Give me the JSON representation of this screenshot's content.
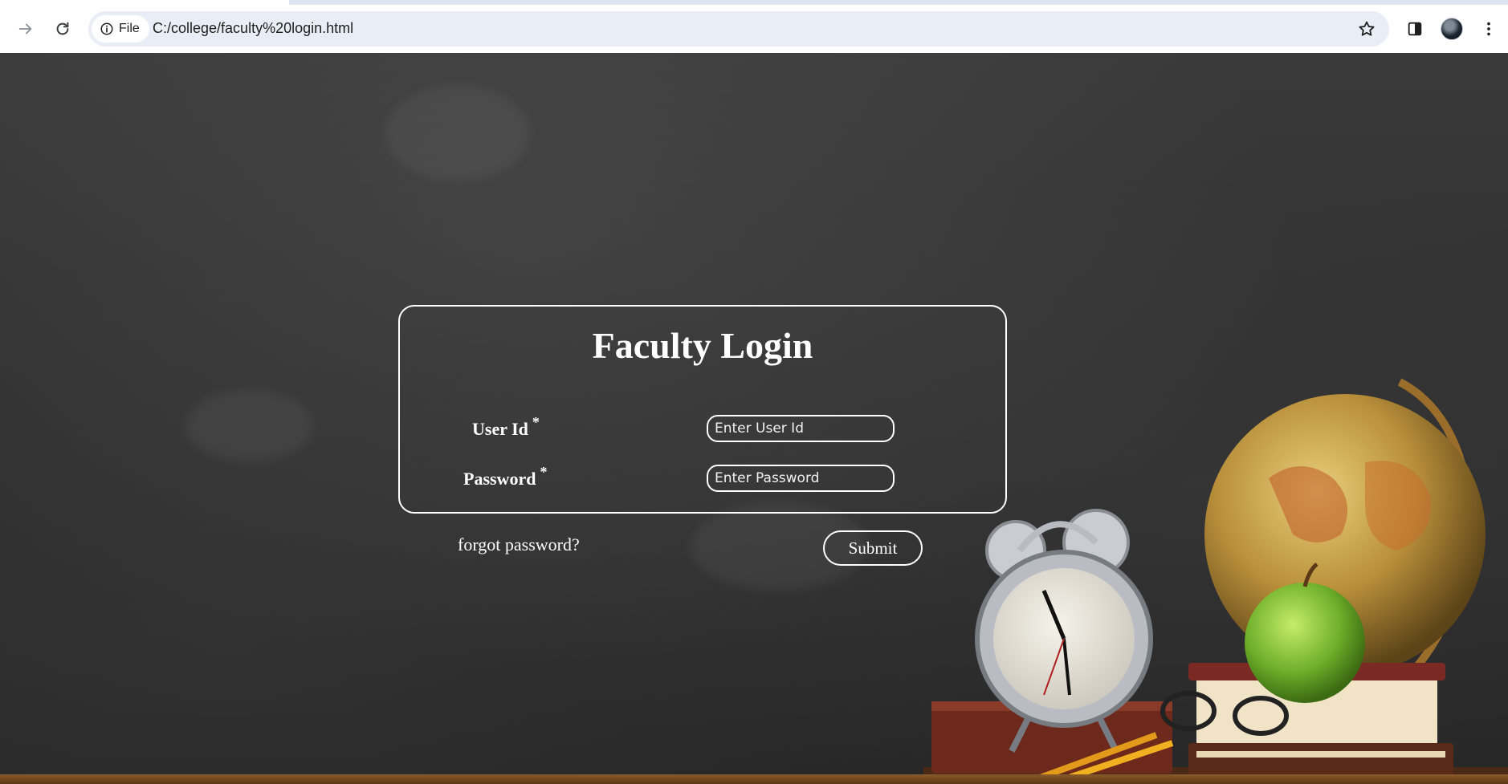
{
  "browser": {
    "site_chip_label": "File",
    "url": "C:/college/faculty%20login.html"
  },
  "login": {
    "title": "Faculty Login",
    "user_id_label": "User Id",
    "password_label": "Password",
    "required_marker": "*",
    "user_id_placeholder": "Enter User Id",
    "password_placeholder": "Enter Password",
    "forgot_password_label": "forgot password?",
    "submit_label": "Submit"
  },
  "colors": {
    "chalkboard": "#2f2f2f",
    "foreground": "#ffffff",
    "omnibox": "#e8edf6"
  }
}
